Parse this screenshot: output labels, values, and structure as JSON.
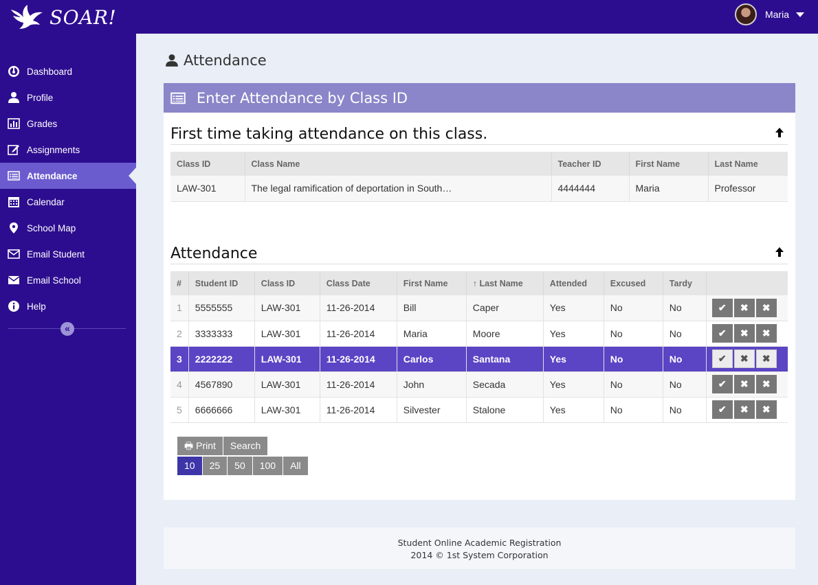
{
  "app": {
    "name": "SOAR!",
    "logo_icon": "eagle-logo-icon"
  },
  "user": {
    "name": "Maria"
  },
  "colors": {
    "sidebar": "#2d0d8f",
    "accent": "#5b45c5",
    "panel_header": "#8b86c9"
  },
  "sidebar": {
    "items": [
      {
        "label": "Dashboard",
        "icon": "dashboard-icon"
      },
      {
        "label": "Profile",
        "icon": "user-icon"
      },
      {
        "label": "Grades",
        "icon": "bar-chart-icon"
      },
      {
        "label": "Assignments",
        "icon": "edit-icon"
      },
      {
        "label": "Attendance",
        "icon": "list-icon",
        "active": true
      },
      {
        "label": "Calendar",
        "icon": "calendar-icon"
      },
      {
        "label": "School Map",
        "icon": "map-marker-icon"
      },
      {
        "label": "Email Student",
        "icon": "envelope-outline-icon"
      },
      {
        "label": "Email School",
        "icon": "envelope-icon"
      },
      {
        "label": "Help",
        "icon": "info-icon"
      }
    ],
    "collapse_label": "«"
  },
  "page": {
    "title": "Attendance"
  },
  "panel": {
    "title": "Enter Attendance by Class ID"
  },
  "class_section": {
    "title": "First time taking attendance on this class.",
    "headers": [
      "Class ID",
      "Class Name",
      "Teacher ID",
      "First Name",
      "Last Name"
    ],
    "rows": [
      [
        "LAW-301",
        "The legal ramification of deportation in South…",
        "4444444",
        "Maria",
        "Professor"
      ]
    ]
  },
  "attendance_section": {
    "title": "Attendance",
    "headers": [
      "#",
      "Student ID",
      "Class ID",
      "Class Date",
      "First Name",
      "↑ Last Name",
      "Attended",
      "Excused",
      "Tardy",
      ""
    ],
    "rows": [
      [
        "1",
        "5555555",
        "LAW-301",
        "11-26-2014",
        "Bill",
        "Caper",
        "Yes",
        "No",
        "No"
      ],
      [
        "2",
        "3333333",
        "LAW-301",
        "11-26-2014",
        "Maria",
        "Moore",
        "Yes",
        "No",
        "No"
      ],
      [
        "3",
        "2222222",
        "LAW-301",
        "11-26-2014",
        "Carlos",
        "Santana",
        "Yes",
        "No",
        "No"
      ],
      [
        "4",
        "4567890",
        "LAW-301",
        "11-26-2014",
        "John",
        "Secada",
        "Yes",
        "No",
        "No"
      ],
      [
        "5",
        "6666666",
        "LAW-301",
        "11-26-2014",
        "Silvester",
        "Stalone",
        "Yes",
        "No",
        "No"
      ]
    ],
    "selected_row": 3,
    "action_icons": [
      "check-icon",
      "times-icon",
      "times-icon"
    ]
  },
  "toolbar": {
    "print_label": "Print",
    "search_label": "Search"
  },
  "page_size": {
    "options": [
      "10",
      "25",
      "50",
      "100",
      "All"
    ],
    "selected": "10"
  },
  "footer": {
    "line1": "Student Online Academic Registration",
    "line2": "2014 © 1st System Corporation"
  }
}
